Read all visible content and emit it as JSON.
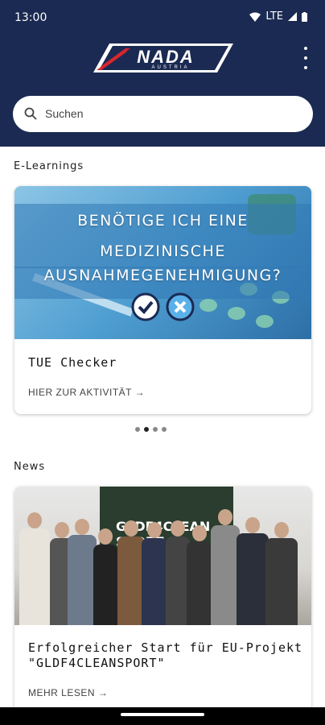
{
  "status_bar": {
    "time": "13:00",
    "network": "LTE"
  },
  "header": {
    "logo_text": "NADA",
    "logo_subtext": "AUSTRIA"
  },
  "search": {
    "placeholder": "Suchen"
  },
  "elearnings": {
    "section_title": "E-Learnings",
    "card": {
      "banner_lines": [
        "BENÖTIGE ICH EINE",
        "MEDIZINISCHE",
        "AUSNAHMEGENEHMIGUNG?"
      ],
      "title": "TUE Checker",
      "link": "HIER ZUR AKTIVITÄT →"
    },
    "pager": {
      "count": 4,
      "active_index": 1
    }
  },
  "news": {
    "section_title": "News",
    "card": {
      "photo_screen_text": "GLDF4CLEAN SPORT",
      "title_line1": "Erfolgreicher Start für EU-Projekt",
      "title_line2": "\"GLDF4CLEANSPORT\"",
      "link": "MEHR LESEN →"
    }
  },
  "colors": {
    "header_bg": "#1b2a52",
    "logo_red": "#d8262e"
  }
}
